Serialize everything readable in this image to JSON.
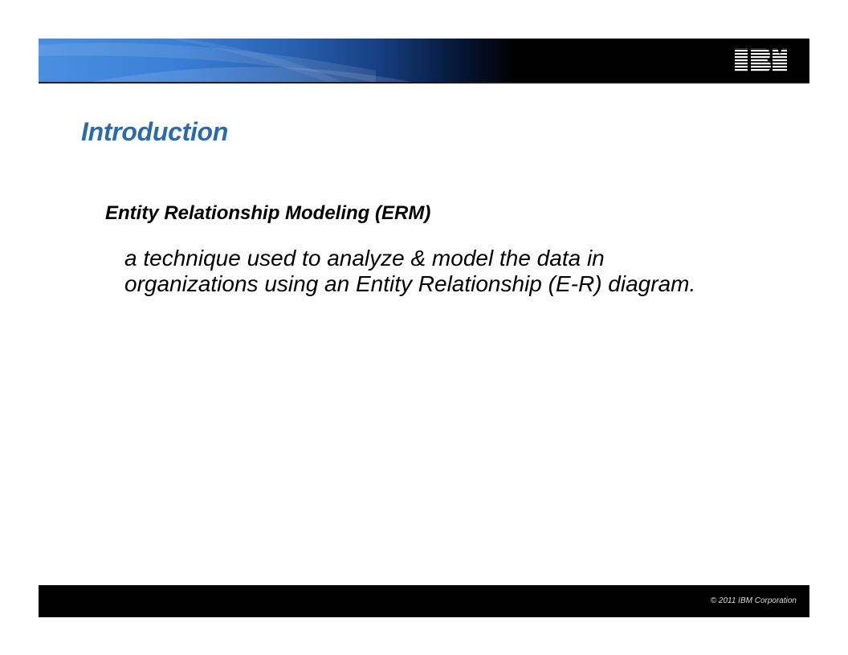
{
  "header": {
    "logo_text": "IBM"
  },
  "slide": {
    "title": "Introduction",
    "heading": "Entity Relationship Modeling (ERM)",
    "body_lines": [
      "a technique used to analyze & model the data in",
      "organizations using an Entity Relationship (E-R) diagram."
    ]
  },
  "footer": {
    "copyright": "© 2011  IBM Corporation"
  },
  "colors": {
    "title": "#2f6aa8",
    "header_blue": "#3a7fd6",
    "header_dark": "#000000",
    "footer": "#000000"
  }
}
